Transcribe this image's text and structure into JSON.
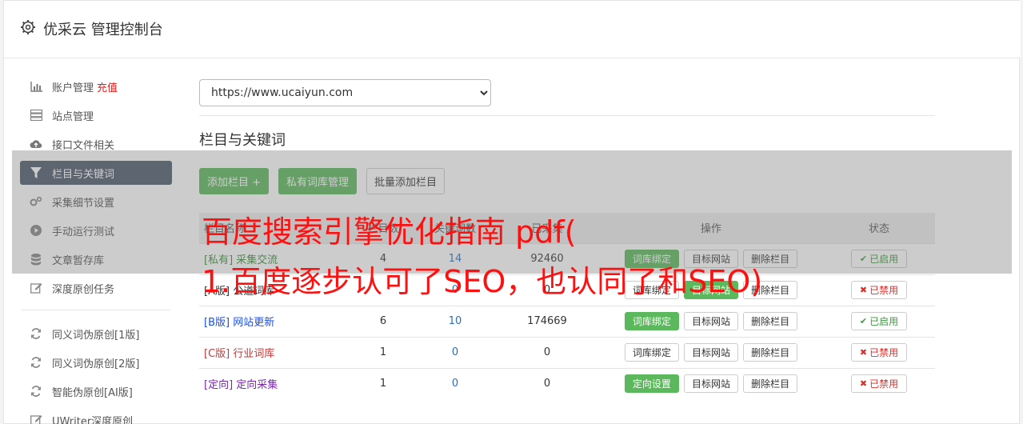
{
  "header": {
    "title": "优采云 管理控制台",
    "icon": "gear-icon"
  },
  "sidebar": {
    "items": [
      {
        "label": "账户管理",
        "extra": "充值",
        "icon": "bar-chart-icon"
      },
      {
        "label": "站点管理",
        "icon": "server-icon"
      },
      {
        "label": "接口文件相关",
        "icon": "cloud-upload-icon"
      },
      {
        "label": "栏目与关键词",
        "icon": "filter-icon",
        "active": true
      },
      {
        "label": "采集细节设置",
        "icon": "cogs-icon"
      },
      {
        "label": "手动运行测试",
        "icon": "play-circle-icon"
      },
      {
        "label": "文章暂存库",
        "icon": "database-icon"
      },
      {
        "label": "深度原创任务",
        "icon": "edit-icon"
      }
    ],
    "items2": [
      {
        "label": "同义词伪原创[1版]",
        "icon": "refresh-icon"
      },
      {
        "label": "同义词伪原创[2版]",
        "icon": "refresh-icon"
      },
      {
        "label": "智能伪原创[AI版]",
        "icon": "refresh-icon"
      },
      {
        "label": "UWriter深度原创",
        "icon": "edit-icon"
      }
    ]
  },
  "main": {
    "site_select": "https://www.ucaiyun.com",
    "section_title": "栏目与关键词",
    "toolbar": {
      "add_column": "添加栏目 +",
      "private_lexicon": "私有词库管理",
      "batch_add": "批量添加栏目"
    },
    "table": {
      "headers": [
        "栏目名称",
        "栏目数",
        "关键词数",
        "已采集",
        "操作",
        "状态"
      ],
      "rows": [
        {
          "tag": "[私有]",
          "name": "采集交流",
          "cols": "4",
          "keywords": "14",
          "collected": "92460",
          "btn1": "词库绑定",
          "btn2": "目标网站",
          "btn3": "删除栏目",
          "status": "已启用"
        },
        {
          "tag": "[A版]",
          "name": "公道词库",
          "cols": "",
          "keywords": "0",
          "collected": "0",
          "btn1": "词库绑定",
          "btn2": "目标网站",
          "btn3": "删除栏目",
          "status": "已禁用"
        },
        {
          "tag": "[B版]",
          "name": "网站更新",
          "cols": "6",
          "keywords": "10",
          "collected": "174669",
          "btn1": "词库绑定",
          "btn2": "目标网站",
          "btn3": "删除栏目",
          "status": "已启用"
        },
        {
          "tag": "[C版]",
          "name": "行业词库",
          "cols": "1",
          "keywords": "0",
          "collected": "0",
          "btn1": "词库绑定",
          "btn2": "目标网站",
          "btn3": "删除栏目",
          "status": "已禁用"
        },
        {
          "tag": "[定向]",
          "name": "定向采集",
          "cols": "1",
          "keywords": "0",
          "collected": "0",
          "btn1": "定向设置",
          "btn2": "目标网站",
          "btn3": "删除栏目",
          "status": "已禁用"
        }
      ]
    }
  },
  "overlay": {
    "line1": "百度搜索引擎优化指南 pdf(",
    "line2": "1.百度逐步认可了SEO，也认同了和SEO)"
  },
  "colors": {
    "accent_green": "#5cb85c",
    "sidebar_active": "#4d5a6b",
    "overlay_text": "#ff1010"
  }
}
